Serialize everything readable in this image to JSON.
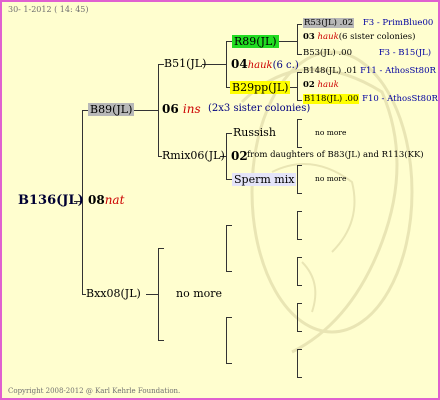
{
  "header": {
    "date": "30- 1-2012 ( 14: 45)"
  },
  "footer": {
    "copyright": "Copyright 2008-2012 @ Karl Kehrle Foundation."
  },
  "gen1": {
    "name": "B136(JL)",
    "count": "08",
    "note": "nat"
  },
  "gen2": {
    "sire": {
      "name": "B89(JL)",
      "count": "06",
      "note": "ins",
      "extra": "(2x3 sister colonies)"
    },
    "dam": {
      "name": "Bxx08(JL)",
      "extra": "no more"
    }
  },
  "gen3": {
    "b51": {
      "name": "B51(JL)",
      "count": "04",
      "note": "hauk",
      "extra": "(6 c.)"
    },
    "rmix": {
      "name": "Rmix06(JL)",
      "count": "02",
      "extra": "from daughters of B83(JL) and R113(KK)"
    }
  },
  "gen4": {
    "r89": {
      "name": "R89(JL)"
    },
    "b29": {
      "name": "B29pp(JL)"
    },
    "russish": {
      "name": "Russish",
      "extra": "no more"
    },
    "sperm": {
      "name": "Sperm mix",
      "extra": "no more"
    }
  },
  "gen5": {
    "r53": {
      "name": "R53(JL)",
      "val": ".02",
      "info": "F3 - PrimBlue00"
    },
    "r53_note": {
      "count": "03",
      "note": "hauk",
      "extra": "(6 sister colonies)"
    },
    "b53": {
      "name": "B53(JL)",
      "val": ".00",
      "info": "F3 - B15(JL)"
    },
    "b148": {
      "name": "B148(JL)",
      "val": ".01",
      "info": "F11 - AthosSt80R"
    },
    "b148_note": {
      "count": "02",
      "note": "hauk"
    },
    "b118": {
      "name": "B118(JL)",
      "val": ".00",
      "info": "F10 - AthosSt80R"
    }
  },
  "colors": {
    "border": "#e060d0",
    "background": "#fffecf",
    "green": "#22dd22",
    "yellow": "#ffff00",
    "gray": "#b8b8b8"
  }
}
